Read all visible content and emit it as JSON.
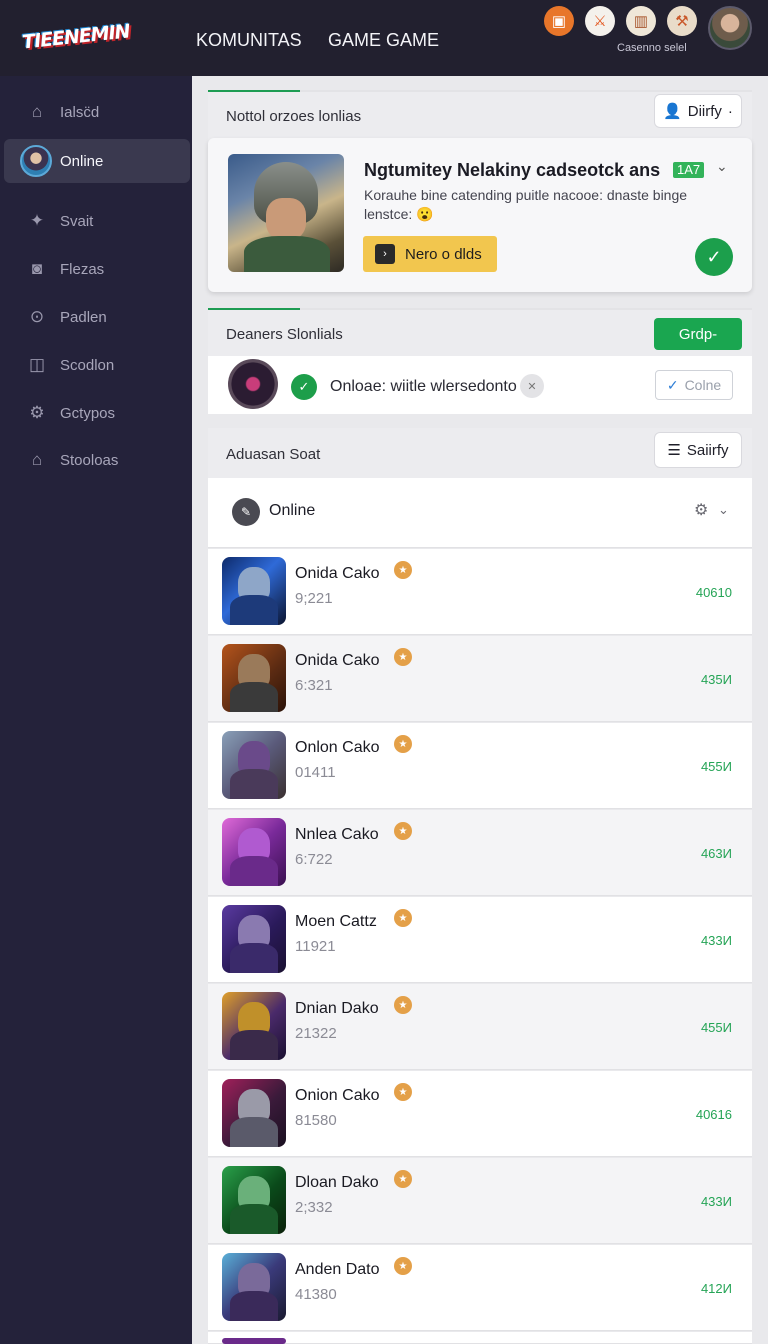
{
  "brand": {
    "logo_text": "TIEENEMIN"
  },
  "nav": {
    "komunitas": "KOMUNITAS",
    "game": "GAME GAME"
  },
  "topbar": {
    "caption": "Casenno selel",
    "icons": [
      "notification-icon",
      "sword-icon",
      "gift-icon",
      "hammer-icon"
    ]
  },
  "sidebar": {
    "items": [
      {
        "label": "Ialsc̈d",
        "icon": "home-icon"
      },
      {
        "label": "Online",
        "icon": "avatar"
      },
      {
        "label": "Svait",
        "icon": "sparkle-icon"
      },
      {
        "label": "Flezas",
        "icon": "camera-icon"
      },
      {
        "label": "Padlen",
        "icon": "coin-icon"
      },
      {
        "label": "Scodlon",
        "icon": "square-icon"
      },
      {
        "label": "Gctypos",
        "icon": "gear-icon"
      },
      {
        "label": "Stooloas",
        "icon": "house-icon"
      }
    ]
  },
  "section1": {
    "title": "Nottol orzoes lonlias",
    "button": "Diirfy",
    "feature": {
      "title": "Ngtumitey Nelakiny cadseotck ans",
      "badge": "1A7",
      "desc": "Korauhe bine catending puitle nacooe: dnaste binge lenstce: 😮",
      "cta": "Nero o dlds"
    }
  },
  "section2": {
    "title": "Deaners Slonlials",
    "button": "Grdp-",
    "row_text": "Onloae: wiitle wlersedonto",
    "outline_button": "Colne"
  },
  "section3": {
    "title": "Aduasan Soat",
    "button": "Saiirfy",
    "filter_label": "Online"
  },
  "list": [
    {
      "name": "Onida Cako",
      "sub": "9;221",
      "score": "40610"
    },
    {
      "name": "Onida Cako",
      "sub": "6:321",
      "score": "435И"
    },
    {
      "name": "Onlon Cako",
      "sub": "01411",
      "score": "455И"
    },
    {
      "name": "Nnlea Cako",
      "sub": "6:722",
      "score": "463И"
    },
    {
      "name": "Moen Cattz",
      "sub": "11921",
      "score": "433И"
    },
    {
      "name": "Dnian Dako",
      "sub": "21322",
      "score": "455И"
    },
    {
      "name": "Onion Cako",
      "sub": "81580",
      "score": "40616"
    },
    {
      "name": "Dloan Dako",
      "sub": "2;332",
      "score": "433И"
    },
    {
      "name": "Anden Dato",
      "sub": "41380",
      "score": "412И"
    }
  ],
  "colors": {
    "accent_green": "#1aa650",
    "sidebar_bg": "#24223a",
    "cta_yellow": "#f2c64e",
    "badge_orange": "#e4a048"
  }
}
